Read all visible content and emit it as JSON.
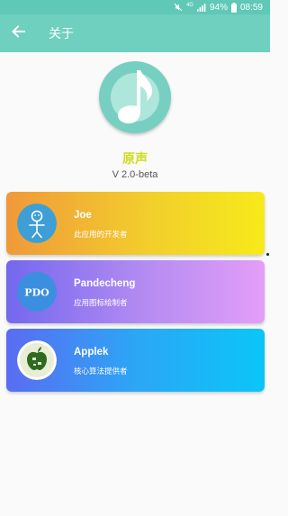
{
  "status_bar": {
    "battery": "94%",
    "time": "08:59",
    "network": "4G",
    "icons": [
      "mute-icon",
      "network-4g-icon",
      "signal-icon",
      "battery-icon"
    ]
  },
  "toolbar": {
    "title": "关于",
    "back_icon": "arrow-back-icon"
  },
  "app": {
    "icon": "music-note-icon",
    "name": "原声",
    "version": "V 2.0-beta"
  },
  "contributors": [
    {
      "name": "Joe",
      "role": "此应用的开发者",
      "avatar": "stick-figure-avatar"
    },
    {
      "name": "Pandecheng",
      "role": "应用图标绘制者",
      "avatar": "PDO"
    },
    {
      "name": "Applek",
      "role": "核心算法提供者",
      "avatar": "apple-logo-avatar"
    }
  ],
  "colors": {
    "status_bar": "#5fc8b6",
    "toolbar": "#6fd0bf",
    "app_name": "#cfdc1e",
    "card_joe": [
      "#f0993a",
      "#f6ea1a"
    ],
    "card_pandecheng": [
      "#7468ee",
      "#e39ef8"
    ],
    "card_applek": [
      "#5a6cf2",
      "#0ac6f8"
    ]
  }
}
